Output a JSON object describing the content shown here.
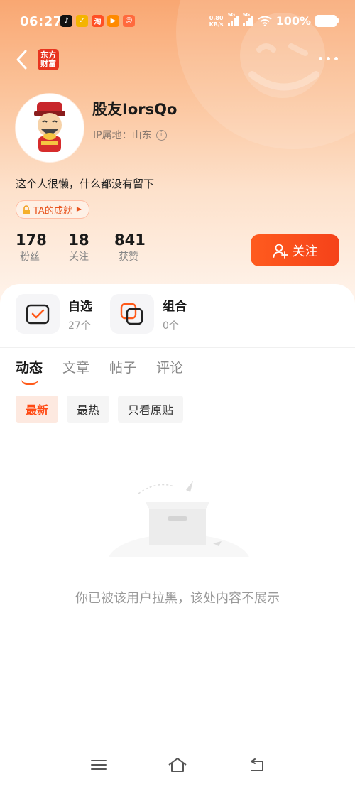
{
  "status_bar": {
    "time": "06:27",
    "net_speed_value": "0.80",
    "net_speed_unit": "KB/s",
    "sim1_label": "5G",
    "sim2_label": "5G",
    "battery": "100%"
  },
  "header": {
    "logo_line1": "东方",
    "logo_line2": "财富"
  },
  "profile": {
    "username": "股友IorsQo",
    "ip_label": "IP属地：山东",
    "bio": "这个人很懒，什么都没有留下",
    "achievement": "TA的成就"
  },
  "stats": [
    {
      "value": "178",
      "label": "粉丝"
    },
    {
      "value": "18",
      "label": "关注"
    },
    {
      "value": "841",
      "label": "获赞"
    }
  ],
  "follow_button": "关注",
  "cards": [
    {
      "title": "自选",
      "count": "27个"
    },
    {
      "title": "组合",
      "count": "0个"
    }
  ],
  "tabs": [
    "动态",
    "文章",
    "帖子",
    "评论"
  ],
  "filters": [
    "最新",
    "最热",
    "只看原贴"
  ],
  "empty_message": "你已被该用户拉黑，该处内容不展示",
  "colors": {
    "accent": "#ff5a1a",
    "hero_top": "#f9a772",
    "logo_red": "#e8351f"
  }
}
